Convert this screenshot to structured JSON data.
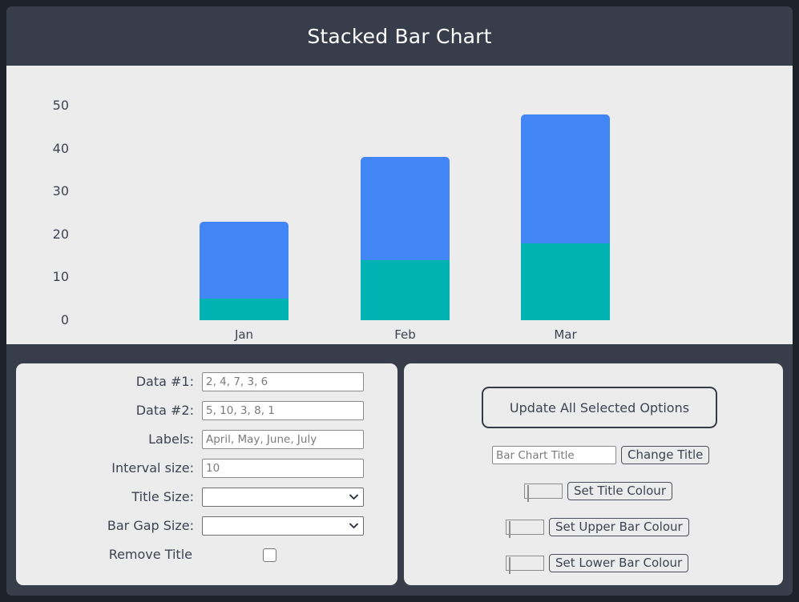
{
  "window": {
    "title": "Stacked Bar Chart"
  },
  "chart_data": {
    "type": "bar",
    "subtype": "stacked",
    "title": "Stacked Bar Chart",
    "categories": [
      "Jan",
      "Feb",
      "Mar"
    ],
    "series": [
      {
        "name": "lower",
        "values": [
          5,
          14,
          18
        ],
        "color": "#00b3b3"
      },
      {
        "name": "upper",
        "values": [
          18,
          24,
          30
        ],
        "color": "#4285f4"
      }
    ],
    "totals": [
      23,
      38,
      48
    ],
    "ylim": [
      0,
      50
    ],
    "yticks": [
      0,
      10,
      20,
      30,
      40,
      50
    ],
    "ytick_labels": [
      "0",
      "10",
      "20",
      "30",
      "40",
      "50"
    ],
    "xlabel": "",
    "ylabel": "",
    "grid": false,
    "legend": false,
    "interval_size": 10,
    "background": "#ececec"
  },
  "controls": {
    "left_panel": {
      "fields": [
        {
          "label": "Data #1:",
          "value": "",
          "placeholder": "2, 4, 7, 3, 6"
        },
        {
          "label": "Data #2:",
          "value": "",
          "placeholder": "5, 10, 3, 8, 1"
        },
        {
          "label": "Labels:",
          "value": "",
          "placeholder": "April, May, June, July"
        },
        {
          "label": "Interval size:",
          "value": "",
          "placeholder": "10"
        }
      ],
      "selects": [
        {
          "label": "Title Size:",
          "value": "",
          "options": []
        },
        {
          "label": "Bar Gap Size:",
          "value": "",
          "options": []
        }
      ],
      "checkbox": {
        "label": "Remove Title",
        "checked": false
      }
    },
    "right_panel": {
      "update_button": "Update All Selected Options",
      "title_input": {
        "value": "",
        "placeholder": "Bar Chart Title"
      },
      "change_title_button": "Change Title",
      "colour_rows": [
        {
          "button": "Set Title Colour",
          "colour": "#ffffff"
        },
        {
          "button": "Set Upper Bar Colour",
          "colour": "#4285f4"
        },
        {
          "button": "Set Lower Bar Colour",
          "colour": "#00b3b3"
        }
      ]
    }
  },
  "theme": {
    "page_background": "#1d2129",
    "panel_dark": "#373d4a",
    "panel_light": "#ececec",
    "text_dark": "#3d4350",
    "text_light": "#ffffff"
  }
}
